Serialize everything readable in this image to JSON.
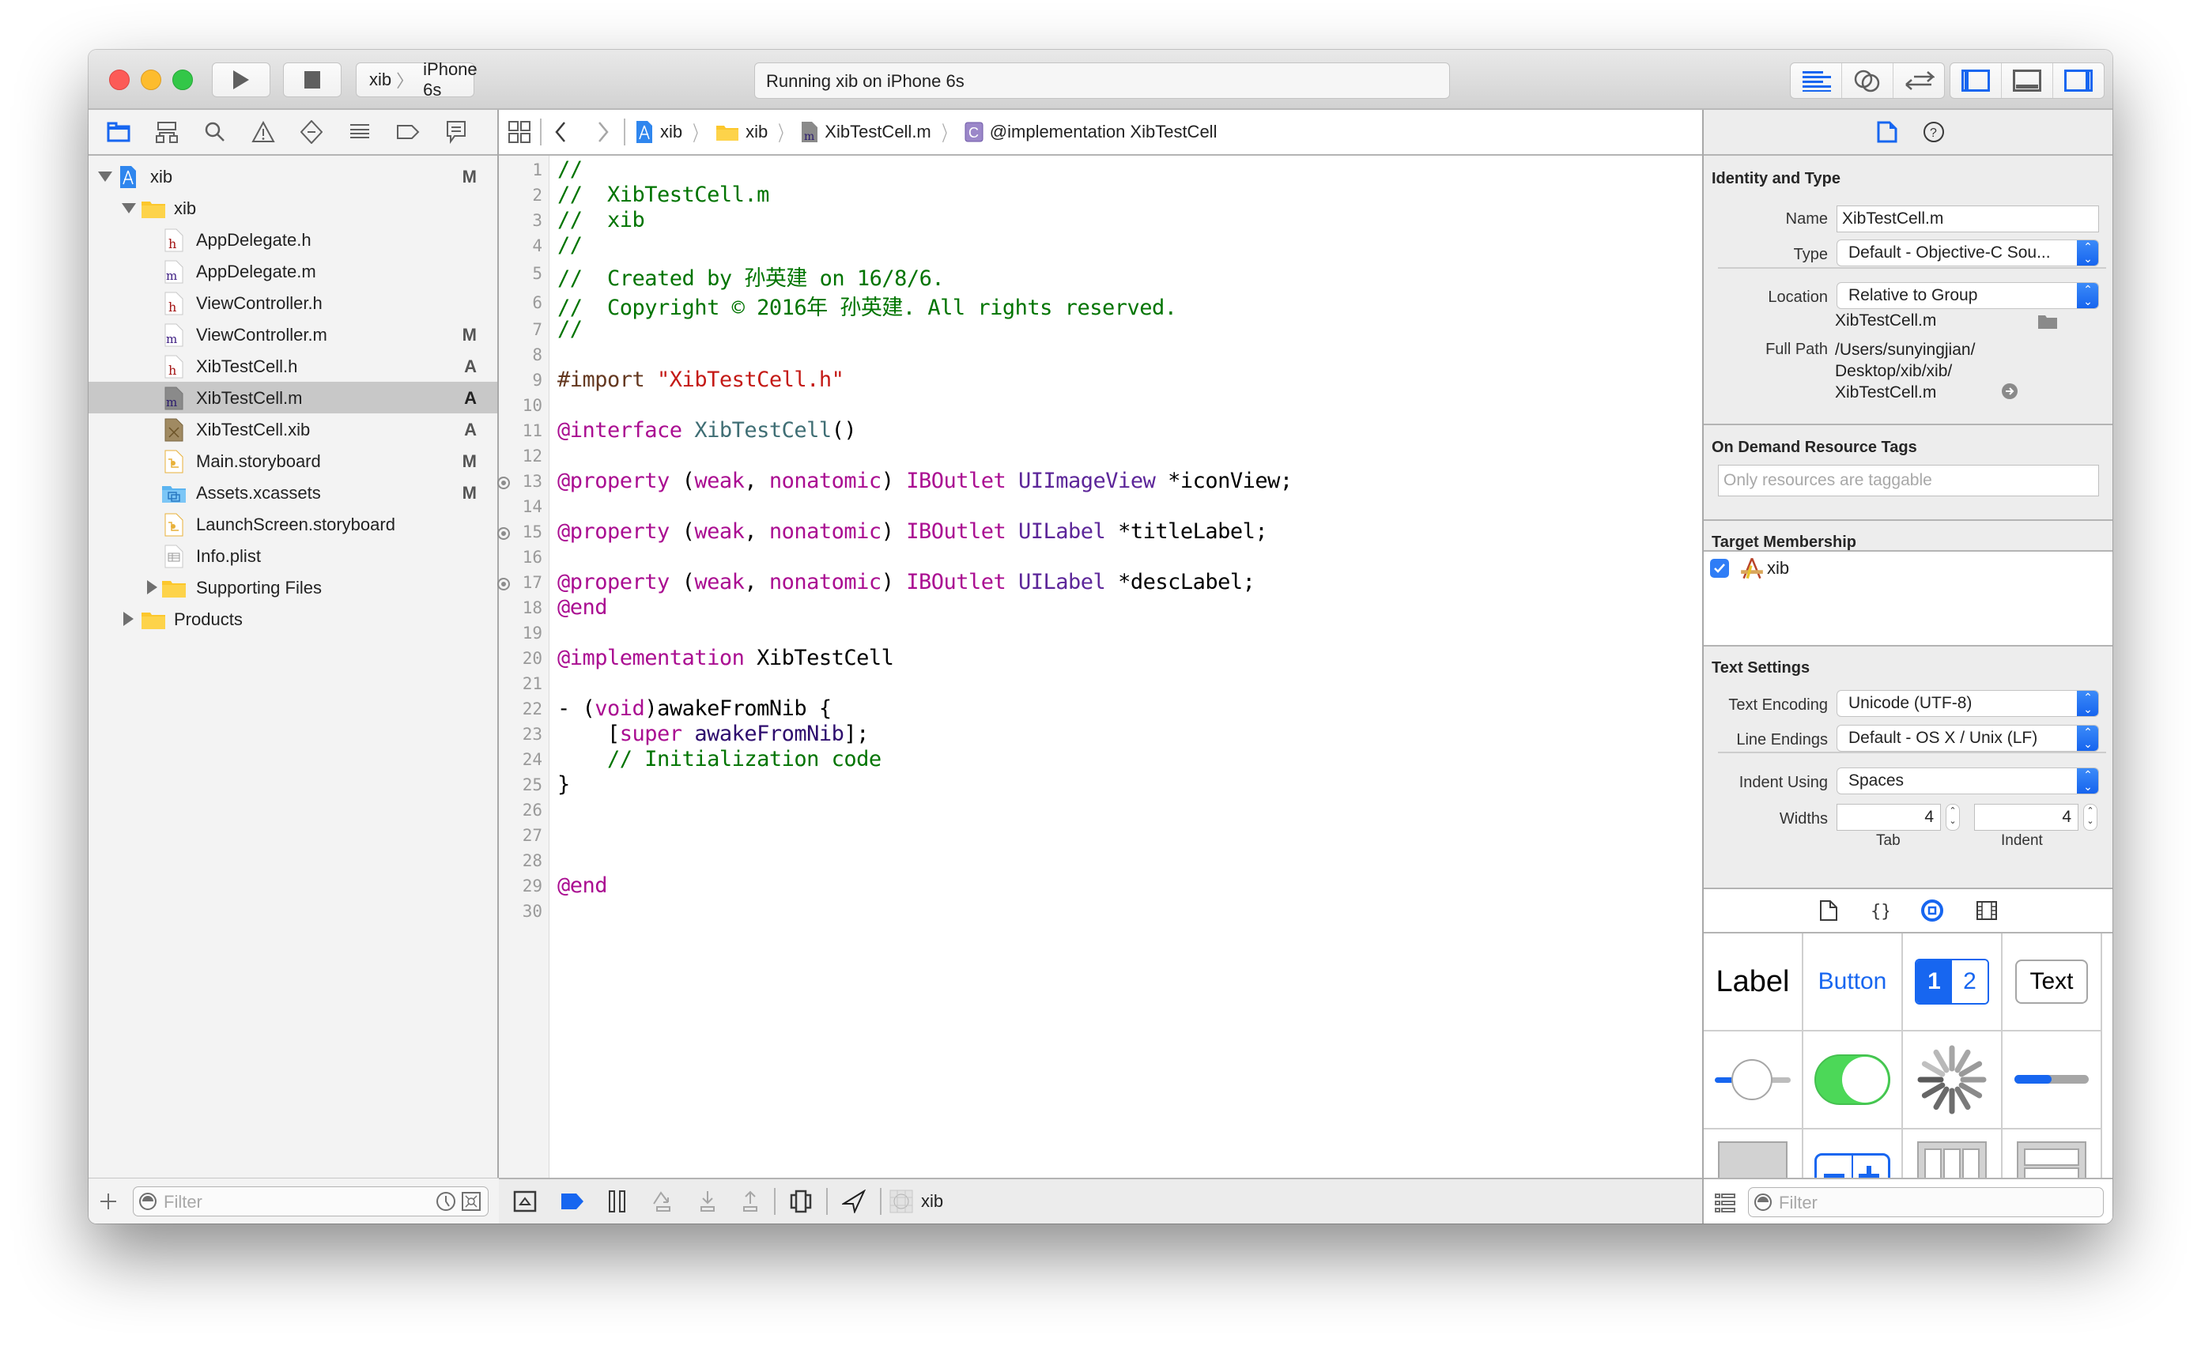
{
  "toolbar": {
    "scheme_target": "xib",
    "scheme_device": "iPhone 6s",
    "activity_status": "Running xib on iPhone 6s",
    "run_icon": "play-icon",
    "stop_icon": "stop-icon",
    "editor_modes": [
      "standard-editor-icon",
      "assistant-editor-icon",
      "version-editor-icon"
    ],
    "view_toggles": [
      "navigator-toggle-icon",
      "debug-area-toggle-icon",
      "utilities-toggle-icon"
    ]
  },
  "navigator": {
    "tabs": [
      "project-navigator",
      "symbol-navigator",
      "find-navigator",
      "issue-navigator",
      "test-navigator",
      "debug-navigator",
      "breakpoint-navigator",
      "report-navigator"
    ],
    "tree": [
      {
        "label": "xib",
        "kind": "project",
        "depth": 0,
        "expanded": true,
        "status": "M"
      },
      {
        "label": "xib",
        "kind": "folder",
        "depth": 1,
        "expanded": true,
        "status": ""
      },
      {
        "label": "AppDelegate.h",
        "kind": "h",
        "depth": 2,
        "status": ""
      },
      {
        "label": "AppDelegate.m",
        "kind": "m",
        "depth": 2,
        "status": ""
      },
      {
        "label": "ViewController.h",
        "kind": "h",
        "depth": 2,
        "status": ""
      },
      {
        "label": "ViewController.m",
        "kind": "m",
        "depth": 2,
        "status": "M"
      },
      {
        "label": "XibTestCell.h",
        "kind": "h",
        "depth": 2,
        "status": "A"
      },
      {
        "label": "XibTestCell.m",
        "kind": "m",
        "depth": 2,
        "status": "A",
        "selected": true
      },
      {
        "label": "XibTestCell.xib",
        "kind": "xib",
        "depth": 2,
        "status": "A"
      },
      {
        "label": "Main.storyboard",
        "kind": "storyboard",
        "depth": 2,
        "status": "M"
      },
      {
        "label": "Assets.xcassets",
        "kind": "assets",
        "depth": 2,
        "status": "M"
      },
      {
        "label": "LaunchScreen.storyboard",
        "kind": "storyboard",
        "depth": 2,
        "status": ""
      },
      {
        "label": "Info.plist",
        "kind": "plist",
        "depth": 2,
        "status": ""
      },
      {
        "label": "Supporting Files",
        "kind": "folder",
        "depth": 2,
        "expanded": false,
        "status": ""
      },
      {
        "label": "Products",
        "kind": "folder",
        "depth": 1,
        "expanded": false,
        "status": ""
      }
    ],
    "filter_placeholder": "Filter"
  },
  "jumpbar": {
    "crumbs": [
      "xib",
      "xib",
      "XibTestCell.m",
      "@implementation XibTestCell"
    ]
  },
  "editor": {
    "lines": [
      {
        "n": "1",
        "tokens": [
          [
            "comment",
            "//"
          ]
        ]
      },
      {
        "n": "2",
        "tokens": [
          [
            "comment",
            "//  XibTestCell.m"
          ]
        ]
      },
      {
        "n": "3",
        "tokens": [
          [
            "comment",
            "//  xib"
          ]
        ]
      },
      {
        "n": "4",
        "tokens": [
          [
            "comment",
            "//"
          ]
        ]
      },
      {
        "n": "5",
        "tokens": [
          [
            "comment",
            "//  Created by 孙英建 on 16/8/6."
          ]
        ]
      },
      {
        "n": "6",
        "tokens": [
          [
            "comment",
            "//  Copyright © 2016年 孙英建. All rights reserved."
          ]
        ]
      },
      {
        "n": "7",
        "tokens": [
          [
            "comment",
            "//"
          ]
        ]
      },
      {
        "n": "8",
        "tokens": []
      },
      {
        "n": "9",
        "tokens": [
          [
            "pre",
            "#import "
          ],
          [
            "string",
            "\"XibTestCell.h\""
          ]
        ]
      },
      {
        "n": "10",
        "tokens": []
      },
      {
        "n": "11",
        "tokens": [
          [
            "kw",
            "@interface"
          ],
          [
            "plain",
            " "
          ],
          [
            "class",
            "XibTestCell"
          ],
          [
            "plain",
            "()"
          ]
        ]
      },
      {
        "n": "12",
        "tokens": []
      },
      {
        "n": "13",
        "outlet": true,
        "tokens": [
          [
            "kw",
            "@property"
          ],
          [
            "plain",
            " ("
          ],
          [
            "kw",
            "weak"
          ],
          [
            "plain",
            ", "
          ],
          [
            "kw",
            "nonatomic"
          ],
          [
            "plain",
            ") "
          ],
          [
            "kw",
            "IBOutlet"
          ],
          [
            "plain",
            " "
          ],
          [
            "type",
            "UIImageView"
          ],
          [
            "plain",
            " *iconView;"
          ]
        ]
      },
      {
        "n": "14",
        "tokens": []
      },
      {
        "n": "15",
        "outlet": true,
        "tokens": [
          [
            "kw",
            "@property"
          ],
          [
            "plain",
            " ("
          ],
          [
            "kw",
            "weak"
          ],
          [
            "plain",
            ", "
          ],
          [
            "kw",
            "nonatomic"
          ],
          [
            "plain",
            ") "
          ],
          [
            "kw",
            "IBOutlet"
          ],
          [
            "plain",
            " "
          ],
          [
            "type",
            "UILabel"
          ],
          [
            "plain",
            " *titleLabel;"
          ]
        ]
      },
      {
        "n": "16",
        "tokens": []
      },
      {
        "n": "17",
        "outlet": true,
        "tokens": [
          [
            "kw",
            "@property"
          ],
          [
            "plain",
            " ("
          ],
          [
            "kw",
            "weak"
          ],
          [
            "plain",
            ", "
          ],
          [
            "kw",
            "nonatomic"
          ],
          [
            "plain",
            ") "
          ],
          [
            "kw",
            "IBOutlet"
          ],
          [
            "plain",
            " "
          ],
          [
            "type",
            "UILabel"
          ],
          [
            "plain",
            " *descLabel;"
          ]
        ]
      },
      {
        "n": "18",
        "tokens": [
          [
            "kw",
            "@end"
          ]
        ]
      },
      {
        "n": "19",
        "tokens": []
      },
      {
        "n": "20",
        "tokens": [
          [
            "kw",
            "@implementation"
          ],
          [
            "plain",
            " XibTestCell"
          ]
        ]
      },
      {
        "n": "21",
        "tokens": []
      },
      {
        "n": "22",
        "tokens": [
          [
            "plain",
            "- ("
          ],
          [
            "kw",
            "void"
          ],
          [
            "plain",
            ")awakeFromNib {"
          ]
        ]
      },
      {
        "n": "23",
        "tokens": [
          [
            "plain",
            "    ["
          ],
          [
            "kw",
            "super"
          ],
          [
            "plain",
            " "
          ],
          [
            "method",
            "awakeFromNib"
          ],
          [
            "plain",
            "];"
          ]
        ]
      },
      {
        "n": "24",
        "tokens": [
          [
            "plain",
            "    "
          ],
          [
            "comment",
            "// Initialization code"
          ]
        ]
      },
      {
        "n": "25",
        "tokens": [
          [
            "plain",
            "}"
          ]
        ]
      },
      {
        "n": "26",
        "tokens": []
      },
      {
        "n": "27",
        "tokens": []
      },
      {
        "n": "28",
        "tokens": []
      },
      {
        "n": "29",
        "tokens": [
          [
            "kw",
            "@end"
          ]
        ]
      },
      {
        "n": "30",
        "tokens": []
      }
    ]
  },
  "debugbar": {
    "process": "xib"
  },
  "inspector": {
    "identity": {
      "title": "Identity and Type",
      "name_label": "Name",
      "name_value": "XibTestCell.m",
      "type_label": "Type",
      "type_value": "Default - Objective-C Sou...",
      "location_label": "Location",
      "location_value": "Relative to Group",
      "relative_path": "XibTestCell.m",
      "full_path_label": "Full Path",
      "full_path_lines": [
        "/Users/sunyingjian/",
        "Desktop/xib/xib/",
        "XibTestCell.m"
      ]
    },
    "odr": {
      "title": "On Demand Resource Tags",
      "placeholder": "Only resources are taggable"
    },
    "membership": {
      "title": "Target Membership",
      "target": "xib",
      "checked": true
    },
    "text_settings": {
      "title": "Text Settings",
      "encoding_label": "Text Encoding",
      "encoding_value": "Unicode (UTF-8)",
      "line_endings_label": "Line Endings",
      "line_endings_value": "Default - OS X / Unix (LF)",
      "indent_using_label": "Indent Using",
      "indent_using_value": "Spaces",
      "widths_label": "Widths",
      "tab_width": "4",
      "indent_width": "4",
      "tab_caption": "Tab",
      "indent_caption": "Indent"
    },
    "library": {
      "tabs": [
        "file-template-library",
        "code-snippet-library",
        "object-library",
        "media-library"
      ],
      "items": {
        "label": "Label",
        "button": "Button",
        "seg_1": "1",
        "seg_2": "2",
        "textfield": "Text"
      },
      "filter_placeholder": "Filter"
    }
  },
  "colors": {
    "accent": "#1766f0",
    "comment": "#007400",
    "keyword": "#aa0d91",
    "string": "#c41a16",
    "type": "#5c2699"
  }
}
